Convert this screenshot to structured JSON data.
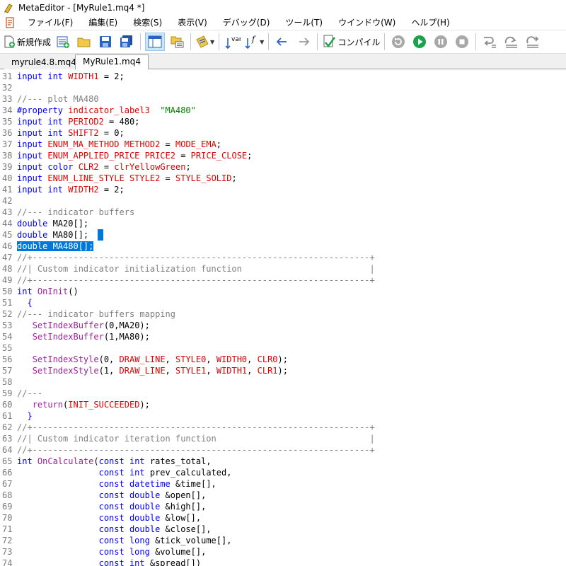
{
  "window": {
    "title": "MetaEditor - [MyRule1.mq4 *]"
  },
  "menu": {
    "items": [
      "ファイル(F)",
      "編集(E)",
      "検索(S)",
      "表示(V)",
      "デバッグ(D)",
      "ツール(T)",
      "ウインドウ(W)",
      "ヘルプ(H)"
    ]
  },
  "toolbar": {
    "new_label": "新規作成",
    "compile_label": "コンパイル",
    "var_label": "var",
    "func_label": "f"
  },
  "tabs": [
    {
      "label": "myrule4.8.mq4",
      "active": false
    },
    {
      "label": "MyRule1.mq4 *",
      "active": true
    }
  ],
  "colors": {
    "keyword": "#0000ff",
    "identifier": "#e00000",
    "function": "#a020a0",
    "comment": "#808080",
    "selection": "#0078d7",
    "accent_green": "#1aa34a"
  },
  "editor": {
    "lines": [
      {
        "n": "31",
        "tokens": [
          {
            "t": "input int ",
            "c": "kw"
          },
          {
            "t": "WIDTH1",
            "c": "id"
          },
          {
            "t": " = 2;",
            "c": "txt"
          }
        ]
      },
      {
        "n": "32",
        "tokens": []
      },
      {
        "n": "33",
        "tokens": [
          {
            "t": "//--- plot MA480",
            "c": "cm"
          }
        ]
      },
      {
        "n": "34",
        "tokens": [
          {
            "t": "#property ",
            "c": "kw"
          },
          {
            "t": "indicator_label3",
            "c": "id"
          },
          {
            "t": "  ",
            "c": "txt"
          },
          {
            "t": "\"MA480\"",
            "c": "str"
          }
        ]
      },
      {
        "n": "35",
        "tokens": [
          {
            "t": "input int ",
            "c": "kw"
          },
          {
            "t": "PERIOD2",
            "c": "id"
          },
          {
            "t": " = 480;",
            "c": "txt"
          }
        ]
      },
      {
        "n": "36",
        "tokens": [
          {
            "t": "input int ",
            "c": "kw"
          },
          {
            "t": "SHIFT2",
            "c": "id"
          },
          {
            "t": " = 0;",
            "c": "txt"
          }
        ]
      },
      {
        "n": "37",
        "tokens": [
          {
            "t": "input ",
            "c": "kw"
          },
          {
            "t": "ENUM_MA_METHOD METHOD2",
            "c": "id"
          },
          {
            "t": " = ",
            "c": "txt"
          },
          {
            "t": "MODE_EMA",
            "c": "id"
          },
          {
            "t": ";",
            "c": "txt"
          }
        ]
      },
      {
        "n": "38",
        "tokens": [
          {
            "t": "input ",
            "c": "kw"
          },
          {
            "t": "ENUM_APPLIED_PRICE PRICE2",
            "c": "id"
          },
          {
            "t": " = ",
            "c": "txt"
          },
          {
            "t": "PRICE_CLOSE",
            "c": "id"
          },
          {
            "t": ";",
            "c": "txt"
          }
        ]
      },
      {
        "n": "39",
        "tokens": [
          {
            "t": "input color ",
            "c": "kw"
          },
          {
            "t": "CLR2",
            "c": "id"
          },
          {
            "t": " = ",
            "c": "txt"
          },
          {
            "t": "clrYellowGreen",
            "c": "id"
          },
          {
            "t": ";",
            "c": "txt"
          }
        ]
      },
      {
        "n": "40",
        "tokens": [
          {
            "t": "input ",
            "c": "kw"
          },
          {
            "t": "ENUM_LINE_STYLE STYLE2",
            "c": "id"
          },
          {
            "t": " = ",
            "c": "txt"
          },
          {
            "t": "STYLE_SOLID",
            "c": "id"
          },
          {
            "t": ";",
            "c": "txt"
          }
        ]
      },
      {
        "n": "41",
        "tokens": [
          {
            "t": "input int ",
            "c": "kw"
          },
          {
            "t": "WIDTH2",
            "c": "id"
          },
          {
            "t": " = 2;",
            "c": "txt"
          }
        ]
      },
      {
        "n": "42",
        "tokens": []
      },
      {
        "n": "43",
        "tokens": [
          {
            "t": "//--- indicator buffers",
            "c": "cm"
          }
        ]
      },
      {
        "n": "44",
        "tokens": [
          {
            "t": "double ",
            "c": "kw"
          },
          {
            "t": "MA20[];",
            "c": "txt"
          }
        ]
      },
      {
        "n": "45",
        "tokens": [
          {
            "t": "double ",
            "c": "kw"
          },
          {
            "t": "MA80[];",
            "c": "txt"
          }
        ],
        "cursor": true
      },
      {
        "n": "46",
        "tokens": [
          {
            "t": "double MA480[];",
            "c": "sel"
          }
        ]
      },
      {
        "n": "47",
        "tokens": [
          {
            "t": "//+------------------------------------------------------------------+",
            "c": "cm"
          }
        ]
      },
      {
        "n": "48",
        "tokens": [
          {
            "t": "//| Custom indicator initialization function                         |",
            "c": "cm"
          }
        ]
      },
      {
        "n": "49",
        "tokens": [
          {
            "t": "//+------------------------------------------------------------------+",
            "c": "cm"
          }
        ]
      },
      {
        "n": "50",
        "tokens": [
          {
            "t": "int ",
            "c": "kw"
          },
          {
            "t": "OnInit",
            "c": "fn"
          },
          {
            "t": "()",
            "c": "txt"
          }
        ]
      },
      {
        "n": "51",
        "tokens": [
          {
            "t": "  {",
            "c": "kw"
          }
        ]
      },
      {
        "n": "52",
        "tokens": [
          {
            "t": "//--- indicator buffers mapping",
            "c": "cm"
          }
        ]
      },
      {
        "n": "53",
        "tokens": [
          {
            "t": "   ",
            "c": "txt"
          },
          {
            "t": "SetIndexBuffer",
            "c": "fn"
          },
          {
            "t": "(0,MA20);",
            "c": "txt"
          }
        ]
      },
      {
        "n": "54",
        "tokens": [
          {
            "t": "   ",
            "c": "txt"
          },
          {
            "t": "SetIndexBuffer",
            "c": "fn"
          },
          {
            "t": "(1,MA80);",
            "c": "txt"
          }
        ]
      },
      {
        "n": "55",
        "tokens": []
      },
      {
        "n": "56",
        "tokens": [
          {
            "t": "   ",
            "c": "txt"
          },
          {
            "t": "SetIndexStyle",
            "c": "fn"
          },
          {
            "t": "(0, ",
            "c": "txt"
          },
          {
            "t": "DRAW_LINE",
            "c": "id"
          },
          {
            "t": ", ",
            "c": "txt"
          },
          {
            "t": "STYLE0",
            "c": "id"
          },
          {
            "t": ", ",
            "c": "txt"
          },
          {
            "t": "WIDTH0",
            "c": "id"
          },
          {
            "t": ", ",
            "c": "txt"
          },
          {
            "t": "CLR0",
            "c": "id"
          },
          {
            "t": ");",
            "c": "txt"
          }
        ]
      },
      {
        "n": "57",
        "tokens": [
          {
            "t": "   ",
            "c": "txt"
          },
          {
            "t": "SetIndexStyle",
            "c": "fn"
          },
          {
            "t": "(1, ",
            "c": "txt"
          },
          {
            "t": "DRAW_LINE",
            "c": "id"
          },
          {
            "t": ", ",
            "c": "txt"
          },
          {
            "t": "STYLE1",
            "c": "id"
          },
          {
            "t": ", ",
            "c": "txt"
          },
          {
            "t": "WIDTH1",
            "c": "id"
          },
          {
            "t": ", ",
            "c": "txt"
          },
          {
            "t": "CLR1",
            "c": "id"
          },
          {
            "t": ");",
            "c": "txt"
          }
        ]
      },
      {
        "n": "58",
        "tokens": []
      },
      {
        "n": "59",
        "tokens": [
          {
            "t": "//---",
            "c": "cm"
          }
        ]
      },
      {
        "n": "60",
        "tokens": [
          {
            "t": "   ",
            "c": "txt"
          },
          {
            "t": "return",
            "c": "fn"
          },
          {
            "t": "(",
            "c": "txt"
          },
          {
            "t": "INIT_SUCCEEDED",
            "c": "id"
          },
          {
            "t": ");",
            "c": "txt"
          }
        ]
      },
      {
        "n": "61",
        "tokens": [
          {
            "t": "  }",
            "c": "kw"
          }
        ]
      },
      {
        "n": "62",
        "tokens": [
          {
            "t": "//+------------------------------------------------------------------+",
            "c": "cm"
          }
        ]
      },
      {
        "n": "63",
        "tokens": [
          {
            "t": "//| Custom indicator iteration function                              |",
            "c": "cm"
          }
        ]
      },
      {
        "n": "64",
        "tokens": [
          {
            "t": "//+------------------------------------------------------------------+",
            "c": "cm"
          }
        ]
      },
      {
        "n": "65",
        "tokens": [
          {
            "t": "int ",
            "c": "kw"
          },
          {
            "t": "OnCalculate",
            "c": "fn"
          },
          {
            "t": "(",
            "c": "txt"
          },
          {
            "t": "const int ",
            "c": "kw"
          },
          {
            "t": "rates_total,",
            "c": "txt"
          }
        ]
      },
      {
        "n": "66",
        "tokens": [
          {
            "t": "                ",
            "c": "txt"
          },
          {
            "t": "const int ",
            "c": "kw"
          },
          {
            "t": "prev_calculated,",
            "c": "txt"
          }
        ]
      },
      {
        "n": "67",
        "tokens": [
          {
            "t": "                ",
            "c": "txt"
          },
          {
            "t": "const datetime ",
            "c": "kw"
          },
          {
            "t": "&time[],",
            "c": "txt"
          }
        ]
      },
      {
        "n": "68",
        "tokens": [
          {
            "t": "                ",
            "c": "txt"
          },
          {
            "t": "const double ",
            "c": "kw"
          },
          {
            "t": "&open[],",
            "c": "txt"
          }
        ]
      },
      {
        "n": "69",
        "tokens": [
          {
            "t": "                ",
            "c": "txt"
          },
          {
            "t": "const double ",
            "c": "kw"
          },
          {
            "t": "&high[],",
            "c": "txt"
          }
        ]
      },
      {
        "n": "70",
        "tokens": [
          {
            "t": "                ",
            "c": "txt"
          },
          {
            "t": "const double ",
            "c": "kw"
          },
          {
            "t": "&low[],",
            "c": "txt"
          }
        ]
      },
      {
        "n": "71",
        "tokens": [
          {
            "t": "                ",
            "c": "txt"
          },
          {
            "t": "const double ",
            "c": "kw"
          },
          {
            "t": "&close[],",
            "c": "txt"
          }
        ]
      },
      {
        "n": "72",
        "tokens": [
          {
            "t": "                ",
            "c": "txt"
          },
          {
            "t": "const long ",
            "c": "kw"
          },
          {
            "t": "&tick_volume[],",
            "c": "txt"
          }
        ]
      },
      {
        "n": "73",
        "tokens": [
          {
            "t": "                ",
            "c": "txt"
          },
          {
            "t": "const long ",
            "c": "kw"
          },
          {
            "t": "&volume[],",
            "c": "txt"
          }
        ]
      },
      {
        "n": "74",
        "tokens": [
          {
            "t": "                ",
            "c": "txt"
          },
          {
            "t": "const int ",
            "c": "kw"
          },
          {
            "t": "&spread[])",
            "c": "txt"
          }
        ]
      }
    ]
  }
}
